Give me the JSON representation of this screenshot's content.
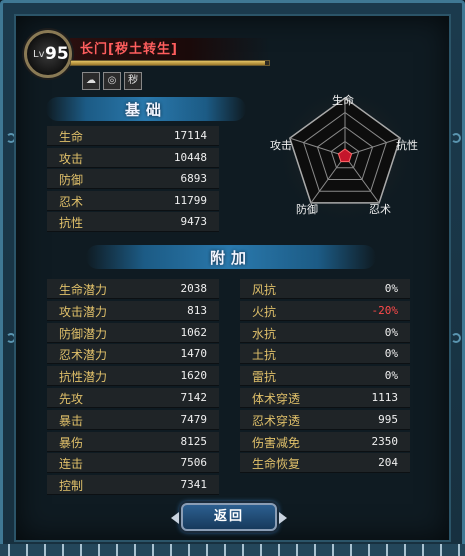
{
  "header": {
    "lv_prefix": "Lv",
    "level": "95",
    "name": "长门[秽土转生]",
    "exp_fraction": 0.98,
    "element_icons": [
      {
        "name": "wind-swirl-icon",
        "glyph": "☁"
      },
      {
        "name": "spiral-icon",
        "glyph": "◎"
      },
      {
        "name": "uchiha-symbol-icon",
        "glyph": "秽"
      }
    ]
  },
  "basic": {
    "title": "基础",
    "stats": [
      {
        "label": "生命",
        "value": "17114"
      },
      {
        "label": "攻击",
        "value": "10448"
      },
      {
        "label": "防御",
        "value": "6893"
      },
      {
        "label": "忍术",
        "value": "11799"
      },
      {
        "label": "抗性",
        "value": "9473"
      }
    ]
  },
  "radar": {
    "labels": {
      "top": "生命",
      "right": "抗性",
      "bottom_right": "忍术",
      "bottom_left": "防御",
      "left": "攻击"
    }
  },
  "extra": {
    "title": "附加",
    "left_stats": [
      {
        "label": "生命潜力",
        "value": "2038"
      },
      {
        "label": "攻击潜力",
        "value": "813"
      },
      {
        "label": "防御潜力",
        "value": "1062"
      },
      {
        "label": "忍术潜力",
        "value": "1470"
      },
      {
        "label": "抗性潜力",
        "value": "1620"
      },
      {
        "label": "先攻",
        "value": "7142"
      },
      {
        "label": "暴击",
        "value": "7479"
      },
      {
        "label": "暴伤",
        "value": "8125"
      },
      {
        "label": "连击",
        "value": "7506"
      },
      {
        "label": "控制",
        "value": "7341"
      }
    ],
    "right_stats": [
      {
        "label": "风抗",
        "value": "0%"
      },
      {
        "label": "火抗",
        "value": "-20%"
      },
      {
        "label": "水抗",
        "value": "0%"
      },
      {
        "label": "土抗",
        "value": "0%"
      },
      {
        "label": "雷抗",
        "value": "0%"
      },
      {
        "label": "体术穿透",
        "value": "1113"
      },
      {
        "label": "忍术穿透",
        "value": "995"
      },
      {
        "label": "伤害减免",
        "value": "2350"
      },
      {
        "label": "生命恢复",
        "value": "204"
      }
    ]
  },
  "buttons": {
    "return_label": "返回"
  },
  "colors": {
    "stat_label": "#e0c06a",
    "negative": "#ff4a4a",
    "name": "#ff5e5e"
  }
}
